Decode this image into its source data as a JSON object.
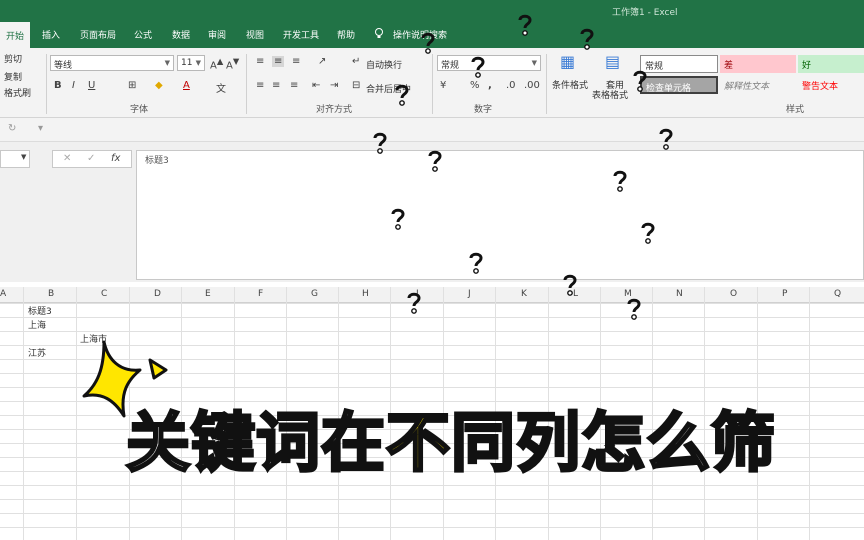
{
  "window": {
    "title": "工作簿1  -  Excel"
  },
  "tabs": [
    "开始",
    "插入",
    "页面布局",
    "公式",
    "数据",
    "审阅",
    "视图",
    "开发工具",
    "帮助"
  ],
  "tell_me": "操作说明搜索",
  "clipboard": {
    "cut": "剪切",
    "copy": "复制",
    "format_painter": "格式刷"
  },
  "font": {
    "name": "等线",
    "size": "11",
    "group_label": "字体"
  },
  "alignment": {
    "wrap": "自动换行",
    "merge": "合并后居中",
    "group_label": "对齐方式"
  },
  "number": {
    "format": "常规",
    "group_label": "数字"
  },
  "styles": {
    "conditional": "条件格式",
    "table_format_1": "套用",
    "table_format_2": "表格格式",
    "normal": "常规",
    "bad": "差",
    "good": "好",
    "check_cell": "检查单元格",
    "explanatory": "解释性文本",
    "warning": "警告文本",
    "group_label": "样式"
  },
  "formula_bar": {
    "content": "标题3"
  },
  "columns": [
    "A",
    "B",
    "C",
    "D",
    "E",
    "F",
    "G",
    "H",
    "I",
    "J",
    "K",
    "L",
    "M",
    "N",
    "O",
    "P",
    "Q"
  ],
  "cells": {
    "b1": "标题3",
    "b2": "上海",
    "c3": "上海市",
    "b4": "江苏"
  },
  "caption": {
    "part1": "关键词在",
    "part2": "不同列",
    "part3": "怎么筛"
  }
}
